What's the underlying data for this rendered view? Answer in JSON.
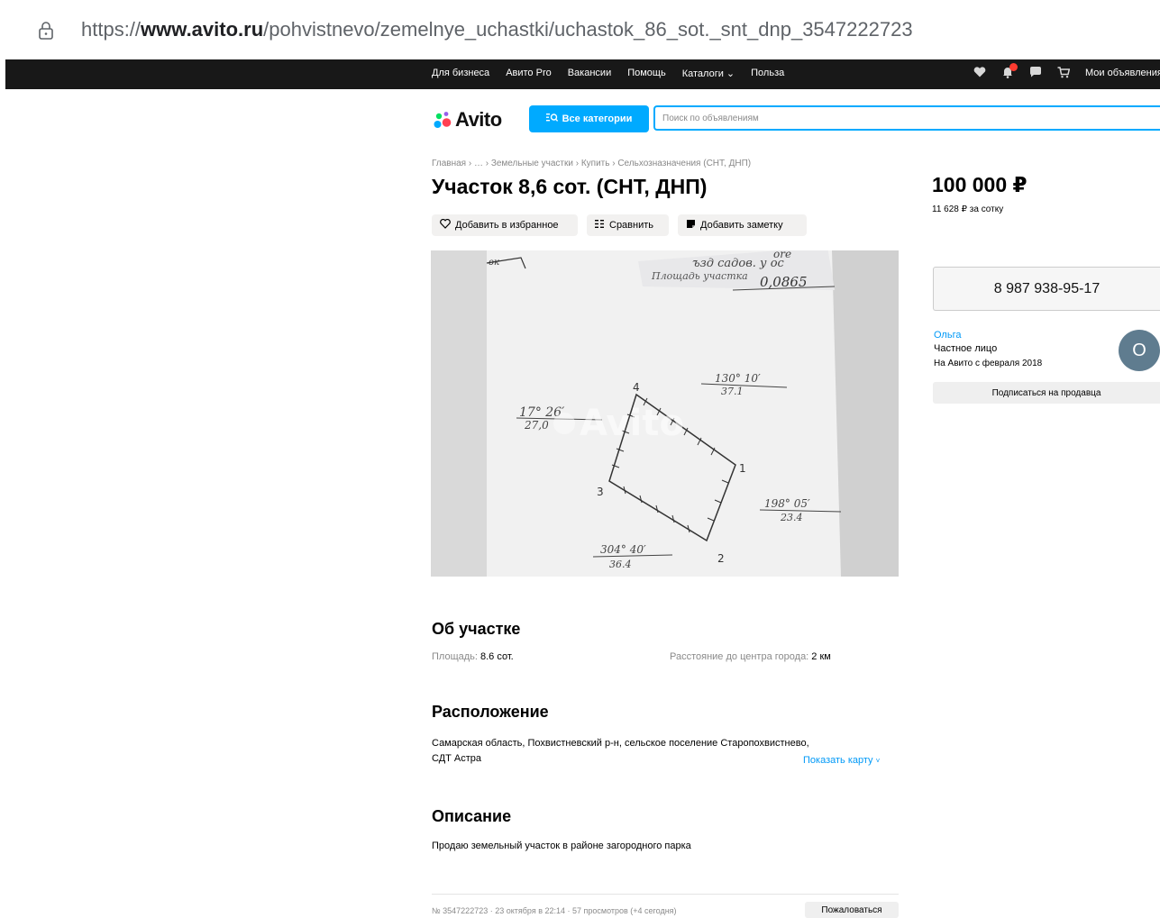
{
  "browser": {
    "url_prefix": "https://",
    "url_domain": "www.avito.ru",
    "url_path": "/pohvistnevo/zemelnye_uchastki/uchastok_86_sot._snt_dnp_3547222723"
  },
  "topnav": {
    "items": [
      "Для бизнеса",
      "Авито Pro",
      "Вакансии",
      "Помощь",
      "Каталоги",
      "Польза"
    ],
    "my_ads": "Мои объявления"
  },
  "header": {
    "logo": "Avito",
    "categories_button": "Все категории",
    "search_placeholder": "Поиск по объявлениям"
  },
  "breadcrumb": "Главная › … › Земельные участки › Купить › Сельхозназначения (СНТ, ДНП)",
  "listing": {
    "title": "Участок 8,6 сот. (СНТ, ДНП)",
    "actions": {
      "favorite": "Добавить в избранное",
      "compare": "Сравнить",
      "note": "Добавить заметку"
    },
    "photo_text": {
      "watermark": "Avito",
      "area_label": "Площадь участка",
      "area_value": "0,0865",
      "line1_angle": "130° 10′",
      "line1_len": "37.1",
      "line2_angle": "17° 26′",
      "line2_len": "27,0",
      "line3_angle": "198° 05′",
      "line3_len": "23.4",
      "line4_angle": "304° 40′",
      "line4_len": "36.4",
      "pt1": "1",
      "pt2": "2",
      "pt3": "3",
      "pt4": "4"
    }
  },
  "sidebar": {
    "price": "100 000 ₽",
    "price_per": "11 628 ₽ за сотку",
    "phone": "8 987 938-95-17",
    "seller_name": "Ольга",
    "seller_type": "Частное лицо",
    "seller_since": "На Авито с февраля 2018",
    "avatar_letter": "О",
    "subscribe": "Подписаться на продавца"
  },
  "about": {
    "heading": "Об участке",
    "area_label": "Площадь: ",
    "area_value": "8.6 сот.",
    "distance_label": "Расстояние до центра города: ",
    "distance_value": "2 км"
  },
  "location": {
    "heading": "Расположение",
    "address": "Самарская область, Похвистневский р-н, сельское поселение Старопохвистнево, СДТ Астра",
    "show_map": "Показать карту"
  },
  "description": {
    "heading": "Описание",
    "text": "Продаю земельный участок в районе загородного парка"
  },
  "footer": {
    "meta": "№ 3547222723 · 23 октября в 22:14 · 57 просмотров (+4 сегодня)",
    "report": "Пожаловаться"
  },
  "colors": {
    "accent": "#00aaff",
    "link": "#0099f7",
    "topbar": "#181818"
  }
}
